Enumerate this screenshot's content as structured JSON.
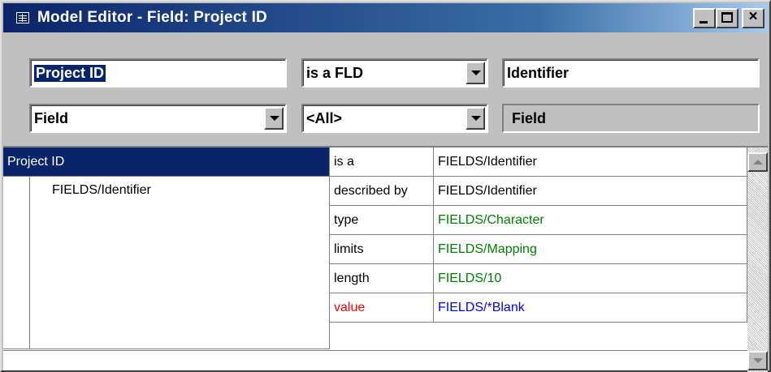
{
  "window": {
    "title": "Model Editor - Field: Project ID",
    "controls": {
      "minimize": "_",
      "maximize": "□",
      "close": "×"
    }
  },
  "header": {
    "name_value": "Project ID",
    "relation_value": "is a FLD",
    "target_value": "Identifier",
    "kind_value": "Field",
    "filter_value": "<All>",
    "kind_label": "Field"
  },
  "grid": {
    "object_name": "Project ID",
    "child_item": "FIELDS/Identifier",
    "rows": [
      {
        "relation": "is a",
        "value": "FIELDS/Identifier",
        "relation_color": "#000000",
        "value_color": "#000000"
      },
      {
        "relation": "described by",
        "value": "FIELDS/Identifier",
        "relation_color": "#000000",
        "value_color": "#000000"
      },
      {
        "relation": "type",
        "value": "FIELDS/Character",
        "relation_color": "#000000",
        "value_color": "#008000"
      },
      {
        "relation": "limits",
        "value": "FIELDS/Mapping",
        "relation_color": "#000000",
        "value_color": "#008000"
      },
      {
        "relation": "length",
        "value": "FIELDS/10",
        "relation_color": "#000000",
        "value_color": "#008000"
      },
      {
        "relation": "value",
        "value": "FIELDS/*Blank",
        "relation_color": "#ff0000",
        "value_color": "#0000ff"
      }
    ]
  },
  "colors": {
    "title_bar": "#0a246a",
    "selection": "#0a246a",
    "green_value": "#008000",
    "red_relation": "#ff0000",
    "blue_value": "#0000ff"
  }
}
